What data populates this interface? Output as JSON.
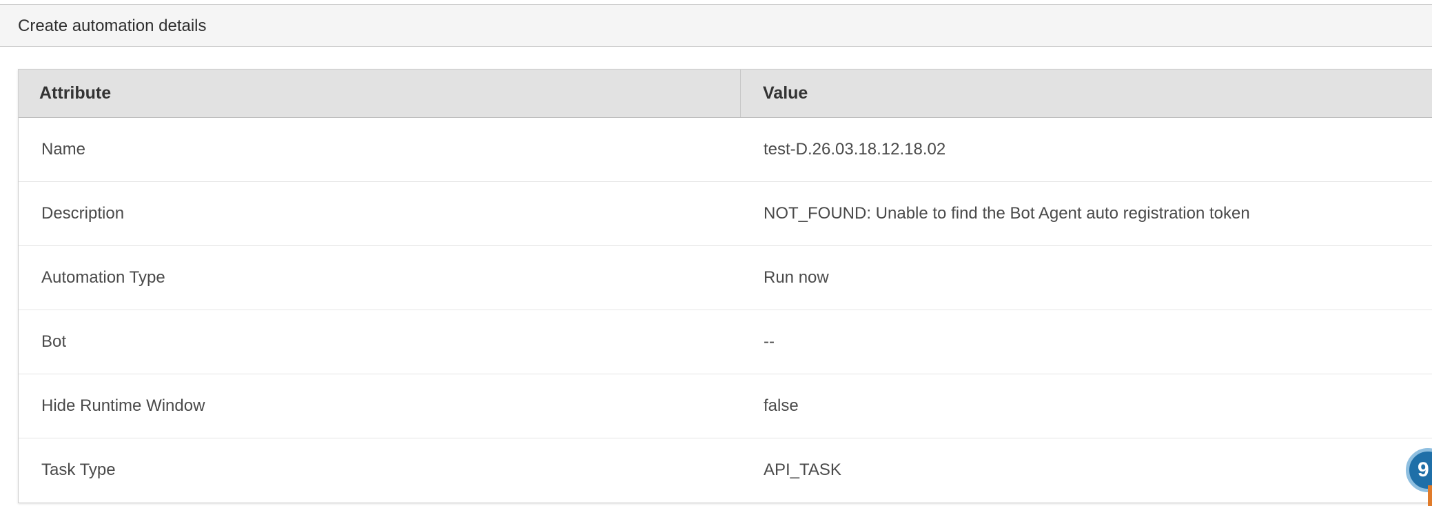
{
  "section": {
    "title": "Create automation details"
  },
  "table": {
    "headers": {
      "attribute": "Attribute",
      "value": "Value"
    },
    "rows": [
      {
        "attribute": "Name",
        "value": "test-D.26.03.18.12.18.02"
      },
      {
        "attribute": "Description",
        "value": "NOT_FOUND: Unable to find the Bot Agent auto registration token"
      },
      {
        "attribute": "Automation Type",
        "value": "Run now"
      },
      {
        "attribute": "Bot",
        "value": "--"
      },
      {
        "attribute": "Hide Runtime Window",
        "value": "false"
      },
      {
        "attribute": "Task Type",
        "value": "API_TASK"
      }
    ]
  },
  "chat_widget": {
    "icon": "chat-bubble-icon",
    "glyph": "9",
    "color": "#1f6fa8"
  }
}
